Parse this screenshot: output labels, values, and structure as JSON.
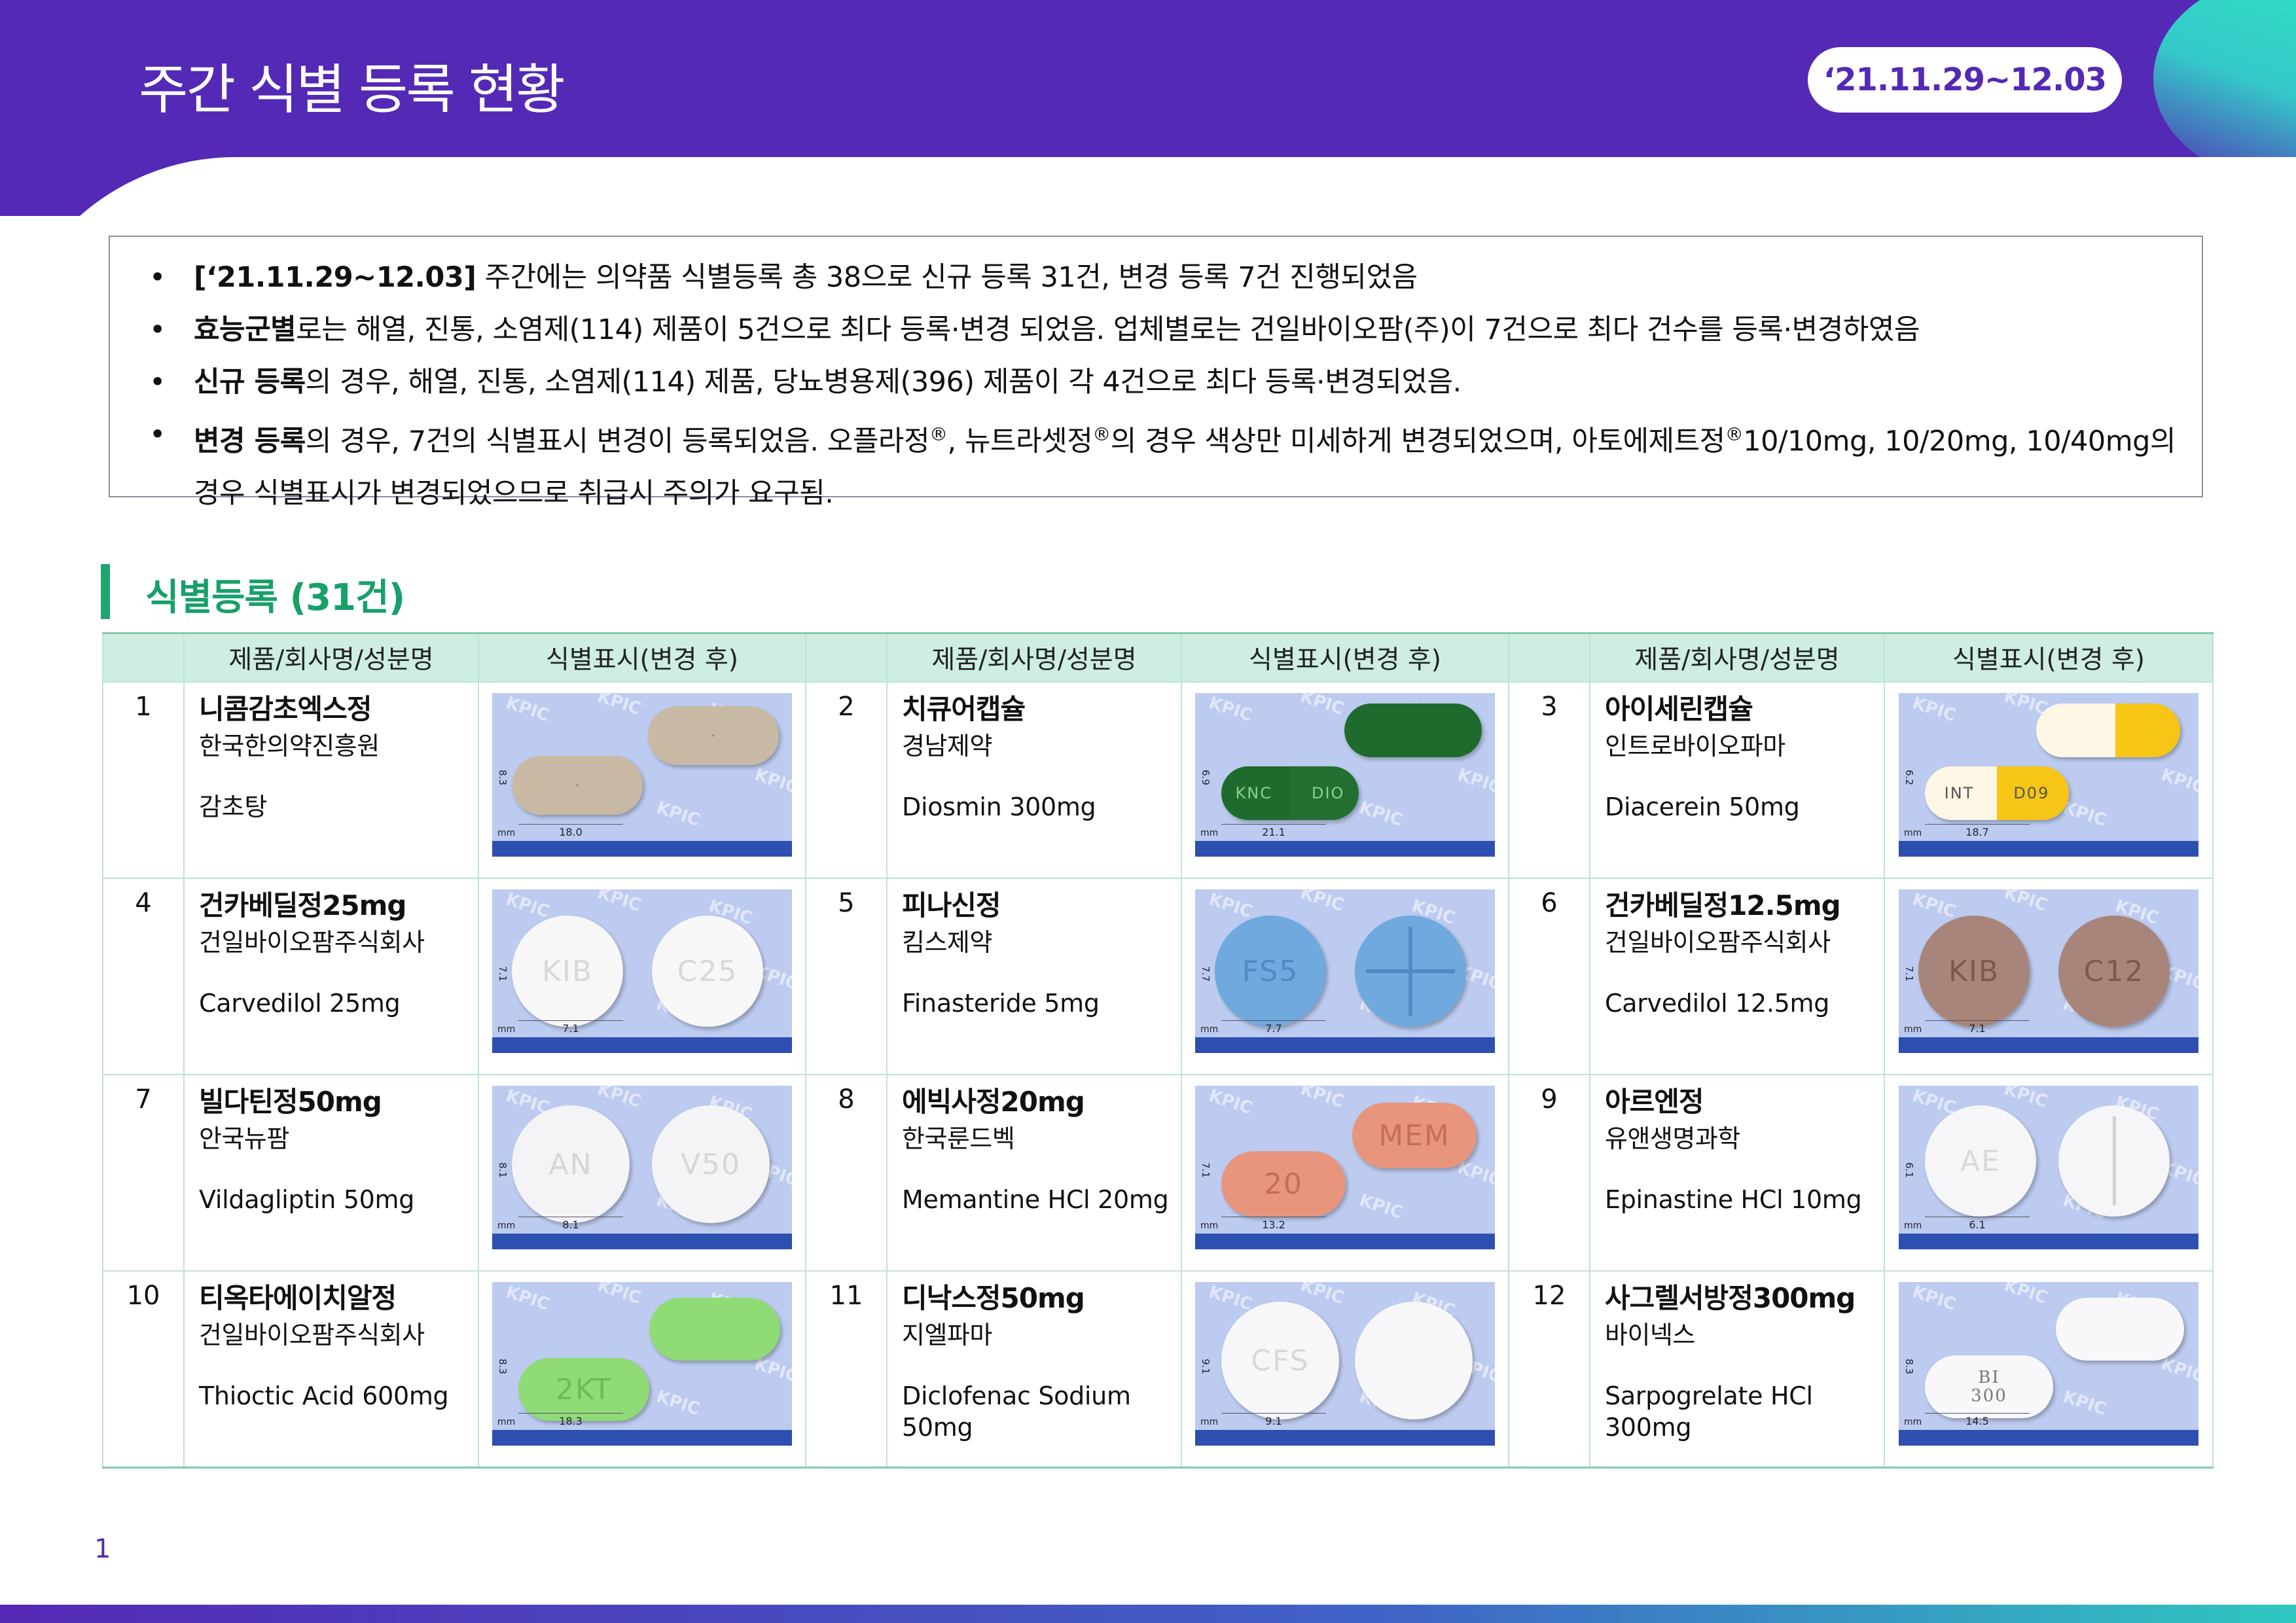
{
  "header": {
    "title": "주간 식별 등록 현황",
    "date_range": "‘21.11.29~12.03"
  },
  "summary": {
    "bullet_glyph": "•",
    "b1_bold": "[‘21.11.29~12.03]",
    "b1_text": " 주간에는 의약품 식별등록 총 38으로 신규 등록 31건, 변경 등록 7건 진행되었음",
    "b2_bold": "효능군별",
    "b2_text": "로는 해열, 진통, 소염제(114) 제품이 5건으로 최다 등록·변경 되었음. 업체별로는 건일바이오팜(주)이 7건으로 최다 건수를 등록·변경하였음",
    "b3_bold": "신규 등록",
    "b3_text": "의 경우, 해열, 진통, 소염제(114) 제품, 당뇨병용제(396) 제품이 각 4건으로 최다 등록·변경되었음.",
    "b4_bold": "변경 등록",
    "b4_t1": "의 경우, 7건의 식별표시 변경이 등록되었음. 오플라정",
    "b4_t2": ", 뉴트라셋정",
    "b4_t3": "의 경우 색상만 미세하게 변경되었으며, 아토에제트정",
    "b4_t4": "10/10mg, 10/20mg, 10/40mg의 경우 식별표시가 변경되었으므로 취급시 주의가 요구됨.",
    "registered_mark": "®"
  },
  "section": {
    "title": "식별등록 (31건)"
  },
  "table": {
    "col_product": "제품/회사명/성분명",
    "col_marking": "식별표시(변경 후)",
    "photo_watermark": "KPIC",
    "mm_label": "mm",
    "rows": [
      [
        {
          "no": "1",
          "name": "니콤감초엑스정",
          "company": "한국한의약진흥원",
          "ingredient": "감초탕",
          "v": "8.3",
          "h": "18.0"
        },
        {
          "no": "2",
          "name": "치큐어캡슐",
          "company": "경남제약",
          "ingredient": "Diosmin 300mg",
          "v": "6.9",
          "h": "21.1",
          "imprint1": "KNC",
          "imprint2": "DIO"
        },
        {
          "no": "3",
          "name": "아이세린캡슐",
          "company": "인트로바이오파마",
          "ingredient": "Diacerein 50mg",
          "v": "6.2",
          "h": "18.7",
          "imprint1": "INT",
          "imprint2": "D09"
        }
      ],
      [
        {
          "no": "4",
          "name": "건카베딜정25mg",
          "company": "건일바이오팜주식회사",
          "ingredient": "Carvedilol 25mg",
          "v": "7.1",
          "h": "7.1",
          "imprint1": "KIB",
          "imprint2": "C25"
        },
        {
          "no": "5",
          "name": "피나신정",
          "company": "킴스제약",
          "ingredient": "Finasteride 5mg",
          "v": "7.7",
          "h": "7.7",
          "imprint1": "FS5"
        },
        {
          "no": "6",
          "name": "건카베딜정12.5mg",
          "company": "건일바이오팜주식회사",
          "ingredient": "Carvedilol 12.5mg",
          "v": "7.1",
          "h": "7.1",
          "imprint1": "KIB",
          "imprint2": "C12"
        }
      ],
      [
        {
          "no": "7",
          "name": "빌다틴정50mg",
          "company": "안국뉴팜",
          "ingredient": "Vildagliptin 50mg",
          "v": "8.1",
          "h": "8.1",
          "imprint1": "AN",
          "imprint2": "V50"
        },
        {
          "no": "8",
          "name": "에빅사정20mg",
          "company": "한국룬드벡",
          "ingredient": "Memantine HCl 20mg",
          "v": "7.1",
          "h": "13.2",
          "imprint1": "20",
          "imprint2": "MEM"
        },
        {
          "no": "9",
          "name": "아르엔정",
          "company": "유앤생명과학",
          "ingredient": "Epinastine HCl 10mg",
          "v": "6.1",
          "h": "6.1",
          "imprint1": "AE"
        }
      ],
      [
        {
          "no": "10",
          "name": "티옥타에이치알정",
          "company": "건일바이오팜주식회사",
          "ingredient": "Thioctic Acid 600mg",
          "v": "8.3",
          "h": "18.3",
          "imprint1": "2KT"
        },
        {
          "no": "11",
          "name": "디낙스정50mg",
          "company": "지엘파마",
          "ingredient": "Diclofenac Sodium 50mg",
          "v": "9.1",
          "h": "9.1",
          "imprint1": "CFS"
        },
        {
          "no": "12",
          "name": "사그렐서방정300mg",
          "company": "바이넥스",
          "ingredient": "Sarpogrelate HCl 300mg",
          "v": "8.3",
          "h": "14.5",
          "imprint1": "BI",
          "imprint2": "300"
        }
      ]
    ]
  },
  "footer": {
    "page_number": "1"
  }
}
